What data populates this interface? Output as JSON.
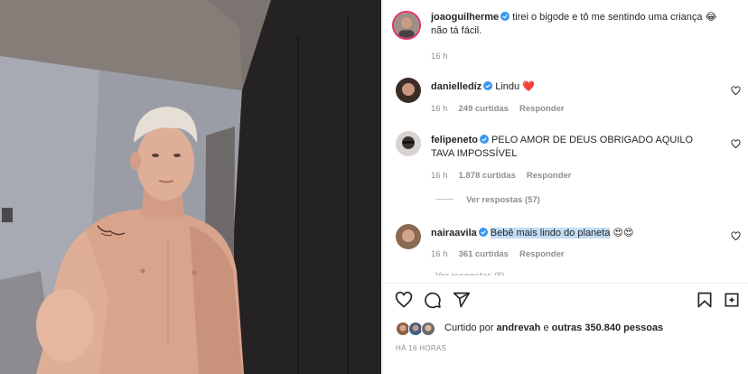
{
  "post": {
    "author": "joaoguilherme",
    "caption_text": "tirei o bigode e tô me sentindo uma criança",
    "caption_emoji": "😂",
    "caption_text_2": "não tá fácil.",
    "age": "16 h"
  },
  "comments": [
    {
      "username": "danielledíz",
      "text": "Lindu",
      "emoji": "❤️",
      "age": "16 h",
      "likes": "249 curtidas",
      "reply": "Responder"
    },
    {
      "username": "felipeneto",
      "text": "PELO AMOR DE DEUS OBRIGADO AQUILO TAVA IMPOSSÍVEL",
      "age": "16 h",
      "likes": "1.878 curtidas",
      "reply": "Responder",
      "view_replies": "Ver respostas (57)"
    },
    {
      "username": "nairaavila",
      "text": "Bebê mais lindo do planeta",
      "emoji": "😍😍",
      "age": "16 h",
      "likes": "361 curtidas",
      "reply": "Responder",
      "view_replies_partial": "Ver respostas (5)"
    }
  ],
  "actions": {
    "like": "heart-icon",
    "comment": "comment-icon",
    "share": "share-icon",
    "save": "bookmark-icon"
  },
  "likes_line": {
    "prefix": "Curtido por",
    "user": "andrevah",
    "middle": "e",
    "others": "outras 350.840 pessoas"
  },
  "posted_ago": "HÁ 16 HORAS",
  "colors": {
    "verified": "#3897f0",
    "heart_red": "#ed4956",
    "highlight": "#c3dcf6",
    "muted": "#8e8e8e"
  }
}
